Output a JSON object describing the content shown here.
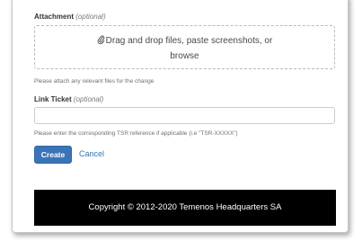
{
  "attachment": {
    "label": "Attachment",
    "optional": "(optional)",
    "dropzone_line1": "Drag and drop files, paste screenshots, or",
    "dropzone_browse": "browse",
    "help": "Please attach any relevant files for the change"
  },
  "link_ticket": {
    "label": "Link Ticket",
    "optional": "(optional)",
    "value": "",
    "help": "Please enter the corresponding TSR reference if applicable (i.e \"TSR-XXXXX\")"
  },
  "actions": {
    "create_label": "Create",
    "cancel_label": "Cancel"
  },
  "footer": {
    "copyright": "Copyright © 2012-2020 Temenos Headquarters SA"
  },
  "colors": {
    "primary": "#3a74b7",
    "footer_bg": "#000000"
  },
  "icons": {
    "attachment": "paperclip-icon"
  }
}
